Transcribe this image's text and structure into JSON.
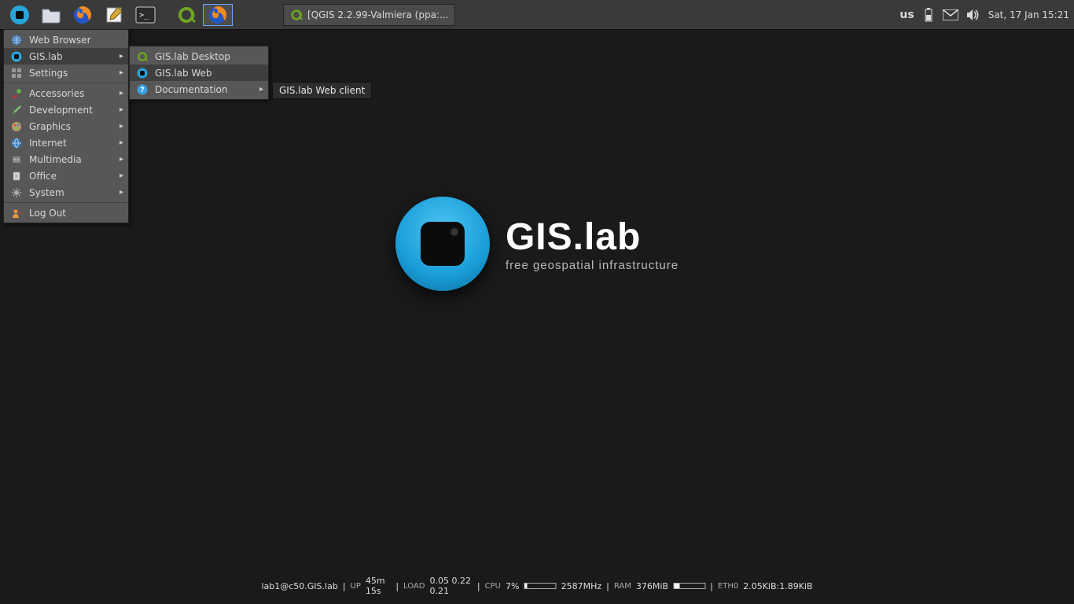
{
  "panel": {
    "taskbar": {
      "title": "[QGIS 2.2.99-Valmiera (ppa:..."
    },
    "kb_layout": "us",
    "datetime": "Sat, 17 Jan  15:21"
  },
  "menu": {
    "items": [
      {
        "label": "Web Browser",
        "has_sub": false,
        "icon": "globe"
      },
      {
        "label": "GIS.lab",
        "has_sub": true,
        "icon": "gislab",
        "selected": true
      },
      {
        "label": "Settings",
        "has_sub": true,
        "icon": "settings",
        "sep_after": true
      },
      {
        "label": "Accessories",
        "has_sub": true,
        "icon": "accessories"
      },
      {
        "label": "Development",
        "has_sub": true,
        "icon": "development"
      },
      {
        "label": "Graphics",
        "has_sub": true,
        "icon": "graphics"
      },
      {
        "label": "Internet",
        "has_sub": true,
        "icon": "internet"
      },
      {
        "label": "Multimedia",
        "has_sub": true,
        "icon": "multimedia"
      },
      {
        "label": "Office",
        "has_sub": true,
        "icon": "office"
      },
      {
        "label": "System",
        "has_sub": true,
        "icon": "system",
        "sep_after": true
      },
      {
        "label": "Log Out",
        "has_sub": false,
        "icon": "logout"
      }
    ]
  },
  "submenu": {
    "items": [
      {
        "label": "GIS.lab Desktop",
        "has_sub": false,
        "icon": "qgis"
      },
      {
        "label": "GIS.lab Web",
        "has_sub": false,
        "icon": "gislab",
        "selected": true
      },
      {
        "label": "Documentation",
        "has_sub": true,
        "icon": "help"
      }
    ]
  },
  "tooltip": "GIS.lab Web client",
  "logo": {
    "title": "GIS.lab",
    "subtitle": "free geospatial infrastructure"
  },
  "status": {
    "host": "lab1@c50.GIS.lab",
    "up_label": "UP",
    "up": "45m 15s",
    "load_label": "LOAD",
    "load": "0.05 0.22 0.21",
    "cpu_label": "CPU",
    "cpu_pct": "7%",
    "cpu_freq": "2587MHz",
    "ram_label": "RAM",
    "ram": "376MiB",
    "eth_label": "ETH0",
    "eth": "2.05KiB:1.89KiB"
  }
}
